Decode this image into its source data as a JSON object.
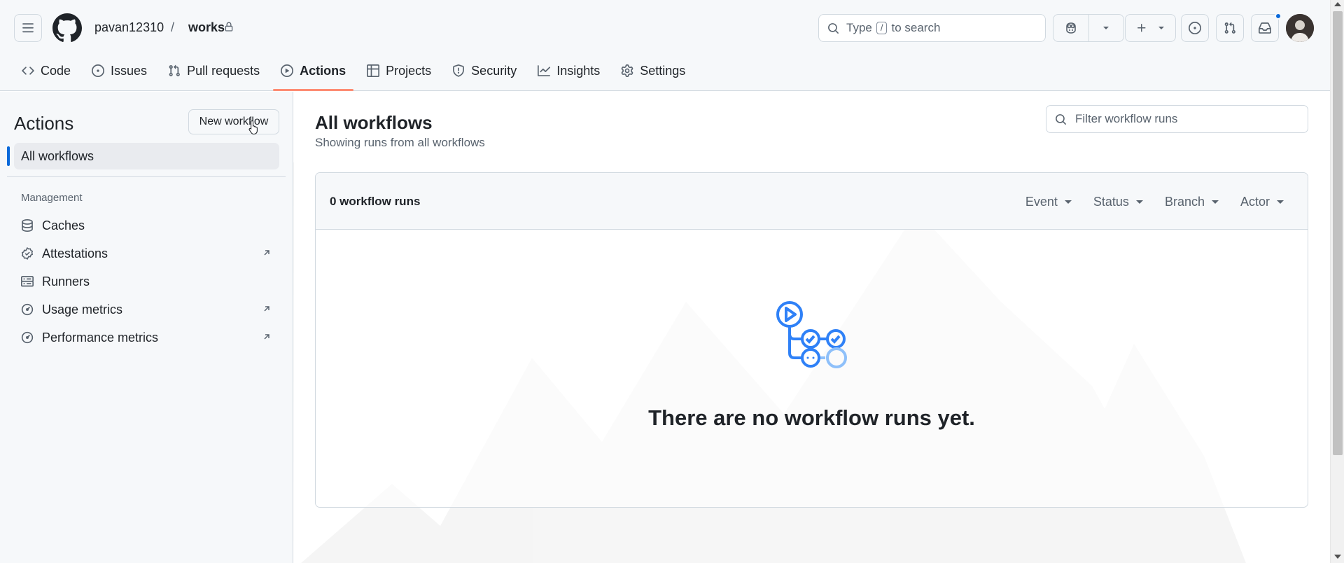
{
  "header": {
    "owner": "pavan12310",
    "separator": "/",
    "repo": "works",
    "search": {
      "prefix": "Type",
      "key": "/",
      "suffix": "to search"
    },
    "icons": [
      "hamburger-icon",
      "github-logo-icon",
      "lock-icon",
      "search-icon",
      "copilot-icon",
      "plus-icon",
      "issues-icon",
      "pull-request-icon",
      "inbox-icon"
    ]
  },
  "tabs": [
    {
      "label": "Code",
      "icon": "code-icon"
    },
    {
      "label": "Issues",
      "icon": "issues-icon"
    },
    {
      "label": "Pull requests",
      "icon": "pull-request-icon"
    },
    {
      "label": "Actions",
      "icon": "play-icon",
      "active": true
    },
    {
      "label": "Projects",
      "icon": "table-icon"
    },
    {
      "label": "Security",
      "icon": "shield-icon"
    },
    {
      "label": "Insights",
      "icon": "graph-icon"
    },
    {
      "label": "Settings",
      "icon": "gear-icon"
    }
  ],
  "sidebar": {
    "title": "Actions",
    "new_workflow": "New workflow",
    "all_workflows": "All workflows",
    "section": "Management",
    "items": [
      {
        "label": "Caches",
        "icon": "database-icon",
        "external": false
      },
      {
        "label": "Attestations",
        "icon": "verified-icon",
        "external": true
      },
      {
        "label": "Runners",
        "icon": "server-icon",
        "external": false
      },
      {
        "label": "Usage metrics",
        "icon": "meter-icon",
        "external": true
      },
      {
        "label": "Performance metrics",
        "icon": "meter-icon",
        "external": true
      }
    ]
  },
  "main": {
    "title": "All workflows",
    "subtitle": "Showing runs from all workflows",
    "filter_placeholder": "Filter workflow runs",
    "runs_count": "0 workflow runs",
    "filters": [
      "Event",
      "Status",
      "Branch",
      "Actor"
    ],
    "empty_message": "There are no workflow runs yet."
  },
  "colors": {
    "accent": "#0969da",
    "tab_underline": "#fd8c73",
    "header_bg": "#f6f8fa",
    "illustration": "#2f81f7"
  }
}
